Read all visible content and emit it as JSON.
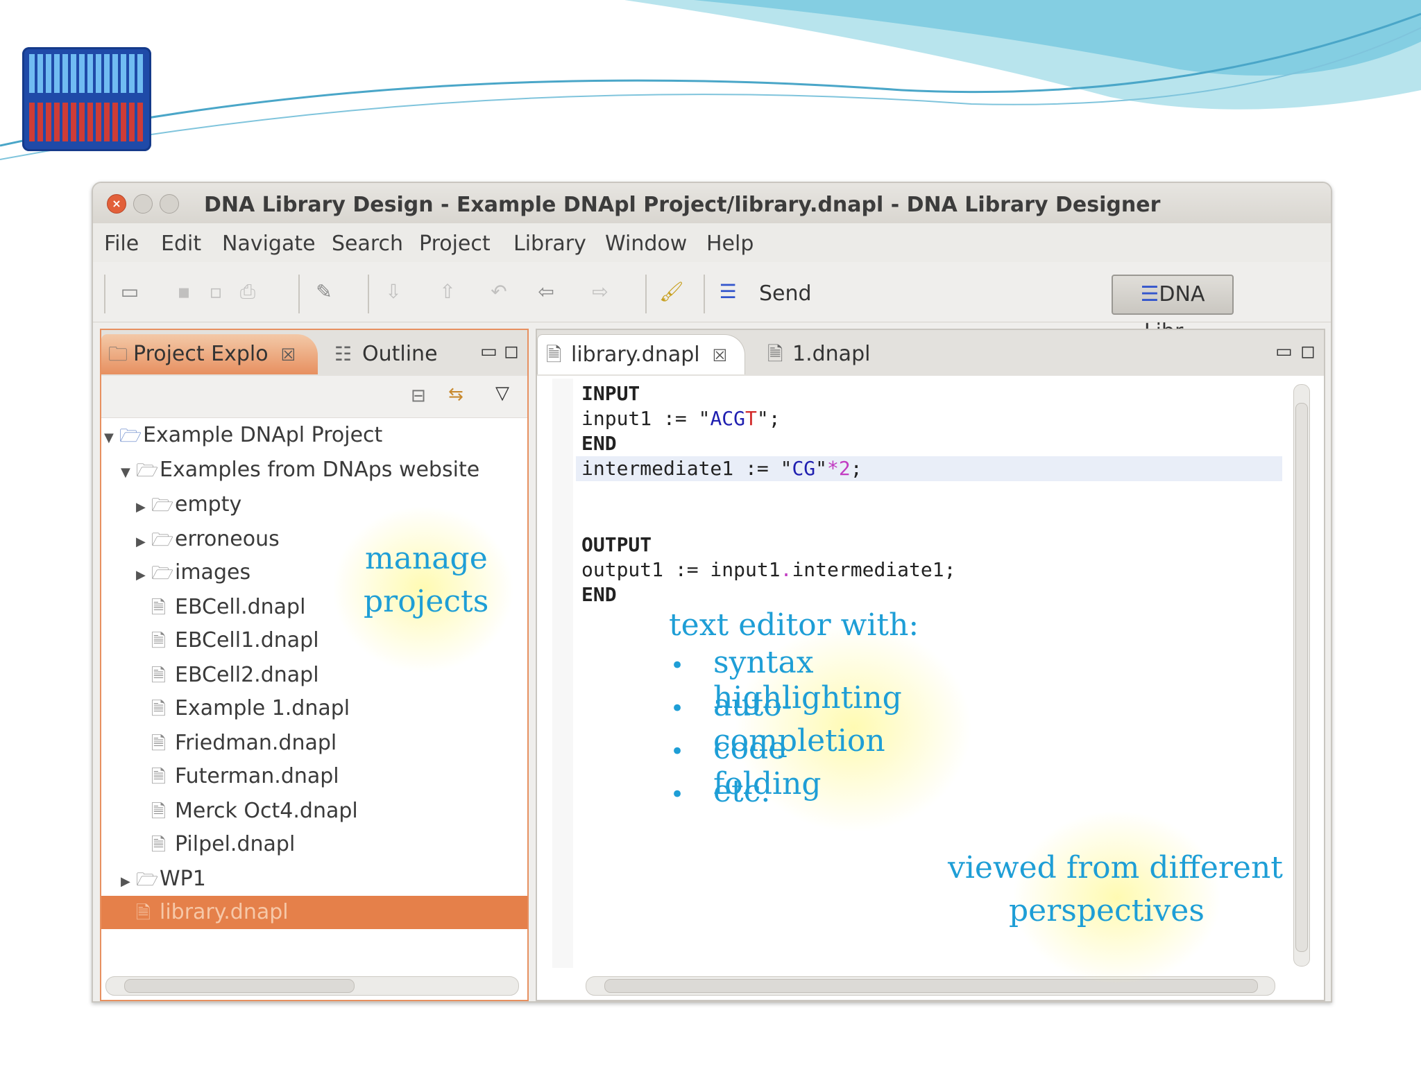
{
  "window": {
    "title": "DNA Library Design - Example DNApl Project/library.dnapl - DNA Library Designer"
  },
  "menu": [
    "File",
    "Edit",
    "Navigate",
    "Search",
    "Project",
    "Library",
    "Window",
    "Help"
  ],
  "toolbar": {
    "send_label": "Send",
    "perspective_label": "DNA Libr..."
  },
  "left_pane": {
    "tabs": [
      {
        "label": "Project Explo",
        "icon": "folder-icon",
        "active": true
      },
      {
        "label": "Outline",
        "icon": "outline-icon",
        "active": false
      }
    ],
    "tree": [
      {
        "label": "Example DNApl Project",
        "type": "project",
        "expanded": true,
        "level": 0
      },
      {
        "label": "Examples from DNAps website",
        "type": "folder",
        "expanded": true,
        "level": 1
      },
      {
        "label": "empty",
        "type": "folder",
        "expanded": false,
        "level": 2
      },
      {
        "label": "erroneous",
        "type": "folder",
        "expanded": false,
        "level": 2
      },
      {
        "label": "images",
        "type": "folder",
        "expanded": false,
        "level": 2
      },
      {
        "label": "EBCell.dnapl",
        "type": "file",
        "level": 2
      },
      {
        "label": "EBCell1.dnapl",
        "type": "file",
        "level": 2
      },
      {
        "label": "EBCell2.dnapl",
        "type": "file",
        "level": 2
      },
      {
        "label": "Example 1.dnapl",
        "type": "file",
        "level": 2
      },
      {
        "label": "Friedman.dnapl",
        "type": "file",
        "level": 2
      },
      {
        "label": "Futerman.dnapl",
        "type": "file",
        "level": 2
      },
      {
        "label": "Merck Oct4.dnapl",
        "type": "file",
        "level": 2
      },
      {
        "label": "Pilpel.dnapl",
        "type": "file",
        "level": 2
      },
      {
        "label": "WP1",
        "type": "folder",
        "expanded": false,
        "level": 1
      },
      {
        "label": "library.dnapl",
        "type": "file",
        "level": 1,
        "selected": true
      }
    ]
  },
  "editor": {
    "tabs": [
      {
        "label": "library.dnapl",
        "active": true
      },
      {
        "label": "1.dnapl",
        "active": false
      }
    ],
    "lines": {
      "l1": "INPUT",
      "l2a": "input1 := \"",
      "l2b": "ACG",
      "l2c": "T",
      "l2d": "\";",
      "l3": "END",
      "l5a": "intermediate1 := \"",
      "l5b": "CG",
      "l5c": "\"",
      "l5d": "*2",
      "l5e": ";",
      "l7": "OUTPUT",
      "l8a": "output1 := input1",
      "l8b": ".",
      "l8c": "intermediate1;",
      "l9": "END"
    }
  },
  "annotations": {
    "manage": [
      "manage",
      "projects"
    ],
    "editor_heading": "text editor with:",
    "bullets": [
      "syntax highlighting",
      "auto-completion",
      "code folding",
      "etc."
    ],
    "bullet_char": "•",
    "perspectives": [
      "viewed from different",
      "perspectives"
    ]
  },
  "colors": {
    "annotation": "#1e9ed6",
    "selection": "#e5804a",
    "active_tab": "#e79060"
  }
}
